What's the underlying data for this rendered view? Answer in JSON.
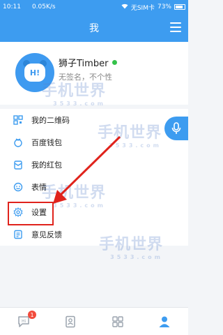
{
  "status_bar": {
    "time": "10:11",
    "speed": "0.05K/s",
    "carrier": "无SIM卡",
    "battery": "73%"
  },
  "header": {
    "title": "我",
    "menu_icon": "hamburger-icon"
  },
  "profile": {
    "avatar_text": "H!",
    "name": "狮子Timber",
    "signature": "无签名，不个性",
    "status_color": "#34c24a"
  },
  "menu": {
    "items": [
      {
        "label": "我的二维码",
        "icon": "qr-code-icon"
      },
      {
        "label": "百度钱包",
        "icon": "wallet-icon"
      },
      {
        "label": "我的红包",
        "icon": "red-envelope-icon"
      },
      {
        "label": "表情",
        "icon": "emoji-icon"
      },
      {
        "label": "设置",
        "icon": "settings-gear-icon"
      },
      {
        "label": "意见反馈",
        "icon": "feedback-icon"
      }
    ]
  },
  "watermark": {
    "text": "手机世界",
    "sub": "3533.com"
  },
  "tabbar": {
    "tabs": [
      {
        "icon": "chat-icon",
        "badge": "1"
      },
      {
        "icon": "contacts-icon"
      },
      {
        "icon": "apps-grid-icon"
      },
      {
        "icon": "me-icon"
      }
    ]
  },
  "colors": {
    "brand": "#3d9cf0",
    "highlight": "#e0231c",
    "badge": "#f24b3c"
  }
}
